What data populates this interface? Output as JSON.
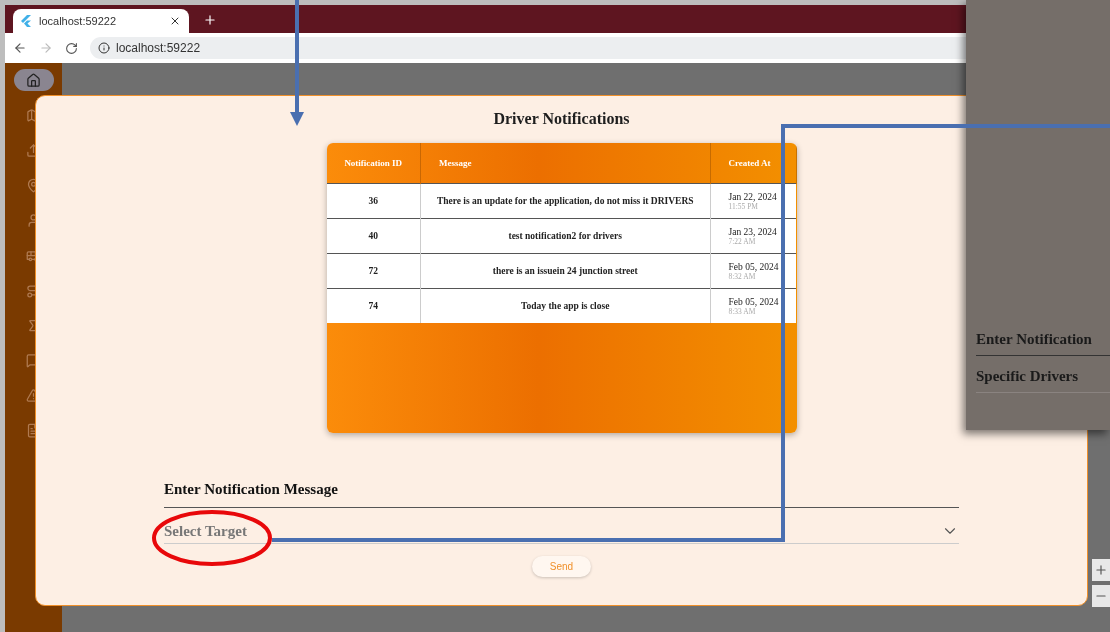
{
  "browser": {
    "tab_title": "localhost:59222",
    "address": "localhost:59222"
  },
  "sidebar": {
    "items": [
      {
        "kind": "home",
        "selected": true
      },
      {
        "kind": "map",
        "selected": false
      },
      {
        "kind": "upload",
        "selected": false
      },
      {
        "kind": "pin",
        "selected": false
      },
      {
        "kind": "user",
        "selected": false
      },
      {
        "kind": "bus",
        "selected": false
      },
      {
        "kind": "route",
        "selected": false
      },
      {
        "kind": "sum",
        "selected": false
      },
      {
        "kind": "chat",
        "selected": false
      },
      {
        "kind": "alert",
        "selected": false
      },
      {
        "kind": "file",
        "selected": false
      }
    ]
  },
  "dialog": {
    "title": "Driver Notifications",
    "table": {
      "columns": [
        "Notification ID",
        "Message",
        "Created At"
      ],
      "rows": [
        {
          "id": "36",
          "message": "There is an update for the application, do not miss it DRIVERS",
          "date": "Jan 22, 2024",
          "time": "11:55 PM"
        },
        {
          "id": "40",
          "message": "test notification2 for drivers",
          "date": "Jan 23, 2024",
          "time": "7:22 AM"
        },
        {
          "id": "72",
          "message": "there is an issuein 24 junction street",
          "date": "Feb 05, 2024",
          "time": "8:32 AM"
        },
        {
          "id": "74",
          "message": "Today the app is close",
          "date": "Feb 05, 2024",
          "time": "8:33 AM"
        }
      ]
    },
    "message_label": "Enter Notification Message",
    "target": {
      "placeholder": "Select Target"
    },
    "send_button": "Send"
  },
  "callout": {
    "items": [
      "Enter Notification",
      "Specific Drivers"
    ]
  }
}
